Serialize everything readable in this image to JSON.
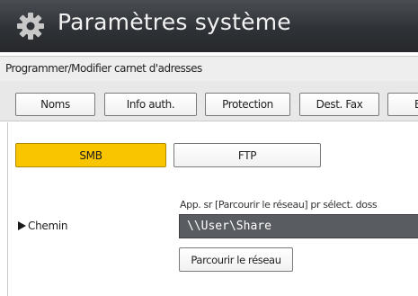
{
  "window": {
    "title": "Paramètres système",
    "icon": "gear-icon"
  },
  "subheader": {
    "title": "Programmer/Modifier carnet d'adresses"
  },
  "tabs": [
    {
      "label": "Noms"
    },
    {
      "label": "Info auth."
    },
    {
      "label": "Protection"
    },
    {
      "label": "Dest. Fax"
    },
    {
      "label": "E"
    }
  ],
  "protocols": {
    "smb_label": "SMB",
    "ftp_label": "FTP",
    "selected": "SMB"
  },
  "path": {
    "hint": "App. sr [Parcourir le réseau] pr sélect. doss",
    "label": "Chemin",
    "value": "\\\\User\\Share",
    "browse_label": "Parcourir le réseau"
  },
  "colors": {
    "titlebar": "#2f3236",
    "selected_button": "#f9c400",
    "input_background": "#595c60"
  }
}
